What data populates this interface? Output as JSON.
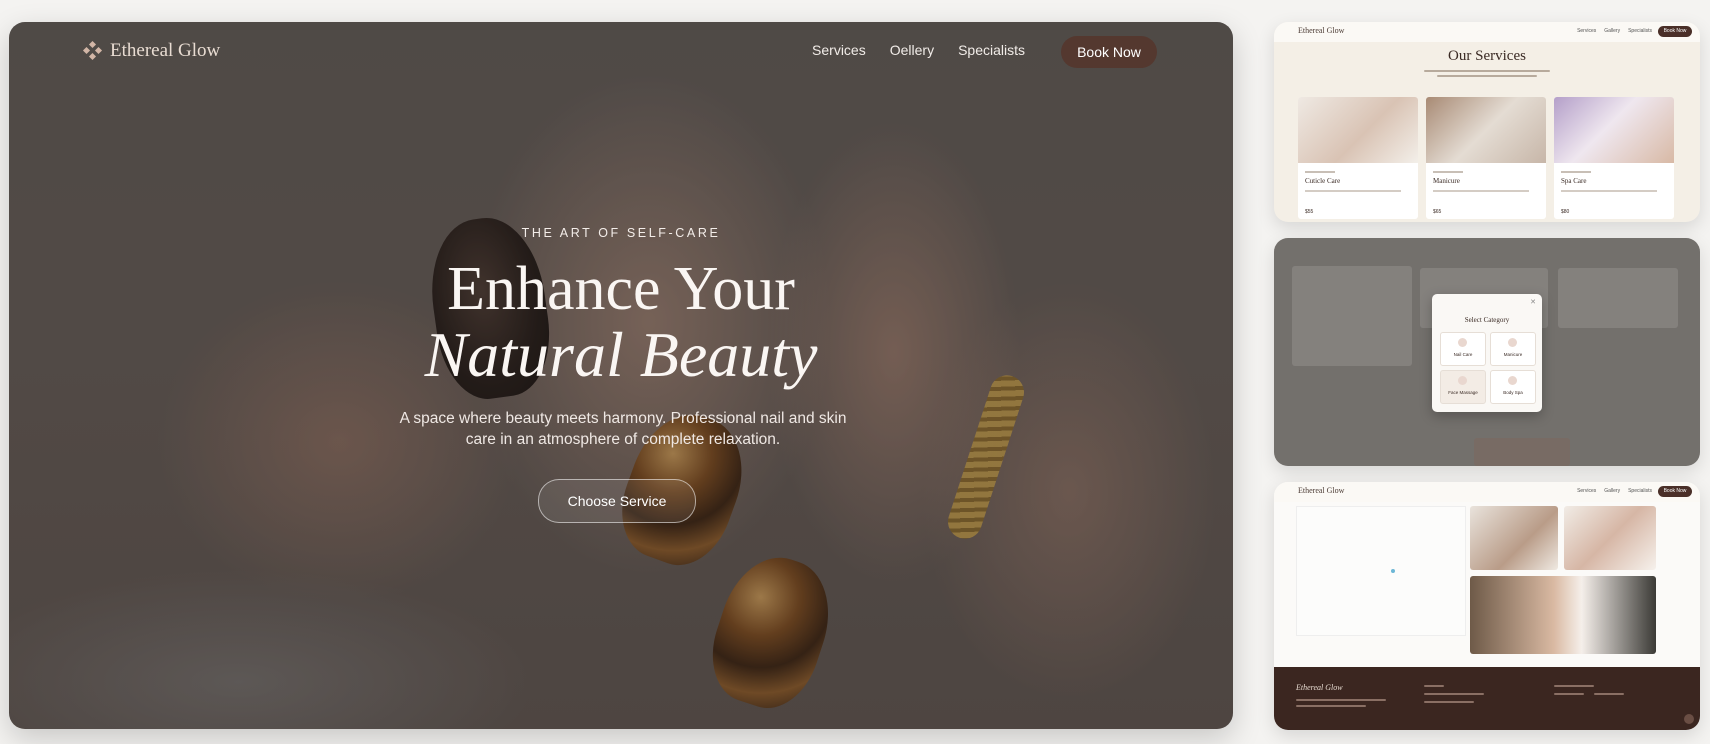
{
  "hero": {
    "brand": "Ethereal Glow",
    "nav": {
      "services": "Services",
      "gallery": "Oellery",
      "specialists": "Specialists"
    },
    "book_label": "Book Now",
    "eyebrow": "THE ART OF SELF-CARE",
    "title_line1": "Enhance Your",
    "title_line2": "Natural Beauty",
    "subtitle": "A space where beauty meets harmony. Professional nail and skin care in an atmosphere of complete relaxation.",
    "cta_label": "Choose Service"
  },
  "services_preview": {
    "brand": "Ethereal Glow",
    "nav": [
      "Services",
      "Gallery",
      "Specialists"
    ],
    "book_label": "Book Now",
    "title": "Our Services"
  },
  "category_preview": {
    "modal_title": "Select Category"
  },
  "footer_preview": {
    "brand": "Ethereal Glow",
    "footer_brand": "Ethereal Glow"
  },
  "colors": {
    "accent": "#54382f",
    "footer_bg": "#3b2620",
    "cream": "#f4efe6"
  }
}
